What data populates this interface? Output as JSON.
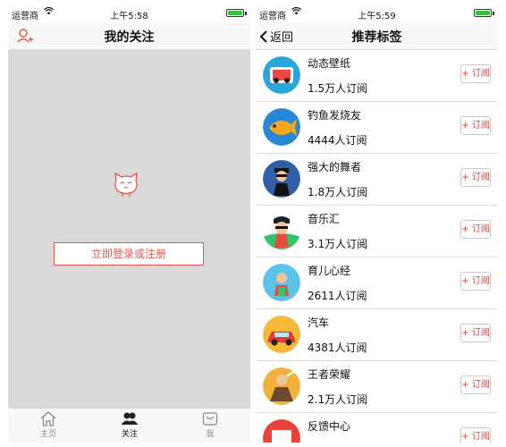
{
  "left_screen": {
    "status": {
      "carrier": "运营商",
      "time": "上午5:58",
      "battery_level": 1.0
    },
    "nav": {
      "title": "我的关注"
    },
    "login_button": "立即登录或注册",
    "tabbar": [
      {
        "label": "主页",
        "icon": "home-icon",
        "active": false
      },
      {
        "label": "关注",
        "icon": "people-icon",
        "active": true
      },
      {
        "label": "我",
        "icon": "inbox-icon",
        "active": false
      }
    ]
  },
  "right_screen": {
    "status": {
      "carrier": "运营商",
      "time": "上午5:59",
      "battery_level": 1.0
    },
    "nav": {
      "back_label": "返回",
      "title": "推荐标签"
    },
    "subscribe_label": "+ 订阅",
    "tags": [
      {
        "name": "动态壁纸",
        "count": "1.5万人订阅",
        "icon": "car-wallpaper-avatar",
        "color": "#2aa7d8"
      },
      {
        "name": "钓鱼发烧友",
        "count": "4444人订阅",
        "icon": "fish-avatar",
        "color": "#2a87d6"
      },
      {
        "name": "强大的舞者",
        "count": "1.8万人订阅",
        "icon": "dancer-avatar",
        "color": "#2f5fa6"
      },
      {
        "name": "音乐汇",
        "count": "3.1万人订阅",
        "icon": "music-avatar",
        "color": "#34c26b"
      },
      {
        "name": "育儿心经",
        "count": "2611人订阅",
        "icon": "parenting-avatar",
        "color": "#5cc3e8"
      },
      {
        "name": "汽车",
        "count": "4381人订阅",
        "icon": "car-avatar",
        "color": "#f5b83a"
      },
      {
        "name": "王者荣耀",
        "count": "2.1万人订阅",
        "icon": "game-avatar",
        "color": "#f0b23a"
      },
      {
        "name": "反馈中心",
        "count": "",
        "icon": "feedback-avatar",
        "color": "#e8423b"
      }
    ]
  }
}
